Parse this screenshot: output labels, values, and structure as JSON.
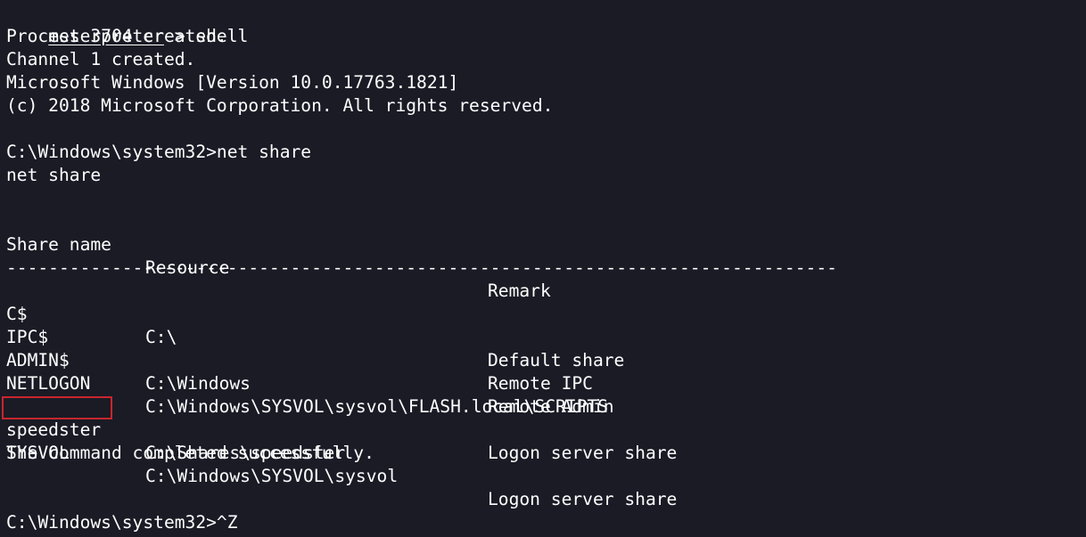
{
  "prompt_line": {
    "prompt": "meterpreter",
    "sep": " > ",
    "command": "shell"
  },
  "output_lines": [
    "Process 3704 created.",
    "Channel 1 created.",
    "Microsoft Windows [Version 10.0.17763.1821]",
    "(c) 2018 Microsoft Corporation. All rights reserved."
  ],
  "cmd_prompt_1": "C:\\Windows\\system32>net share",
  "echo_line": "net share",
  "table": {
    "headers": [
      "Share name",
      "Resource",
      "Remark"
    ],
    "separator": "-------------------------------------------------------------------------------",
    "rows": [
      [
        "C$",
        "C:\\",
        "Default share"
      ],
      [
        "IPC$",
        "",
        "Remote IPC"
      ],
      [
        "ADMIN$",
        "C:\\Windows",
        "Remote Admin"
      ],
      [
        "NETLOGON",
        "C:\\Windows\\SYSVOL\\sysvol\\FLASH.local\\SCRIPTS",
        ""
      ],
      [
        "",
        "",
        "Logon server share"
      ],
      [
        "speedster",
        "C:\\Shares\\speedster",
        ""
      ],
      [
        "SYSVOL",
        "C:\\Windows\\SYSVOL\\sysvol",
        "Logon server share"
      ]
    ]
  },
  "completion": "The command completed successfully.",
  "cmd_prompt_2": "C:\\Windows\\system32>^Z",
  "highlight_color": "#c8262c"
}
